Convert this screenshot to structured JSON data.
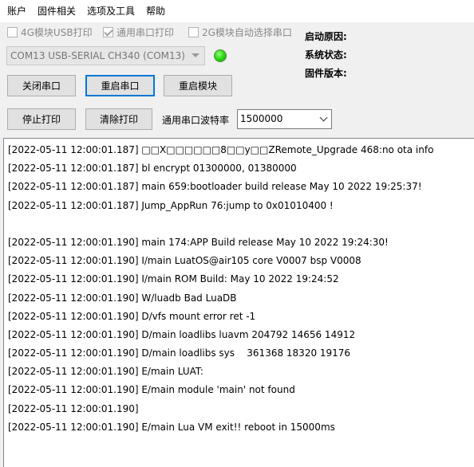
{
  "menu": [
    "账户",
    "固件相关",
    "选项及工具",
    "帮助"
  ],
  "checkboxes": [
    {
      "label": "4G模块USB打印",
      "checked": false
    },
    {
      "label": "通用串口打印",
      "checked": true
    },
    {
      "label": "2G模块自动选择串口",
      "checked": false
    }
  ],
  "info": {
    "boot_reason_label": "启动原因:",
    "system_status_label": "系统状态:",
    "firmware_version_label": "固件版本:"
  },
  "port_select": {
    "value": "COM13 USB-SERIAL CH340 (COM13)"
  },
  "status_led": {
    "color": "#22cc11",
    "state": "connected"
  },
  "buttons": {
    "close_port": "关闭串口",
    "restart_port": "重启串口",
    "restart_module": "重启模块",
    "stop_print": "停止打印",
    "clear_print": "清除打印"
  },
  "baud": {
    "label": "通用串口波特率",
    "value": "1500000"
  },
  "log": [
    "[2022-05-11 12:00:01.187] □□X□□□□□□8□□y□□ZRemote_Upgrade 468:no ota info",
    "[2022-05-11 12:00:01.187] bl encrypt 01300000, 01380000",
    "[2022-05-11 12:00:01.187] main 659:bootloader build release May 10 2022 19:25:37!",
    "[2022-05-11 12:00:01.187] Jump_AppRun 76:jump to 0x01010400 !",
    "",
    "[2022-05-11 12:00:01.190] main 174:APP Build release May 10 2022 19:24:30!",
    "[2022-05-11 12:00:01.190] I/main LuatOS@air105 core V0007 bsp V0008",
    "[2022-05-11 12:00:01.190] I/main ROM Build: May 10 2022 19:24:52",
    "[2022-05-11 12:00:01.190] W/luadb Bad LuaDB",
    "[2022-05-11 12:00:01.190] D/vfs mount error ret -1",
    "[2022-05-11 12:00:01.190] D/main loadlibs luavm 204792 14656 14912",
    "[2022-05-11 12:00:01.190] D/main loadlibs sys    361368 18320 19176",
    "[2022-05-11 12:00:01.190] E/main LUAT:",
    "[2022-05-11 12:00:01.190] E/main module 'main' not found",
    "[2022-05-11 12:00:01.190]",
    "[2022-05-11 12:00:01.190] E/main Lua VM exit!! reboot in 15000ms"
  ]
}
